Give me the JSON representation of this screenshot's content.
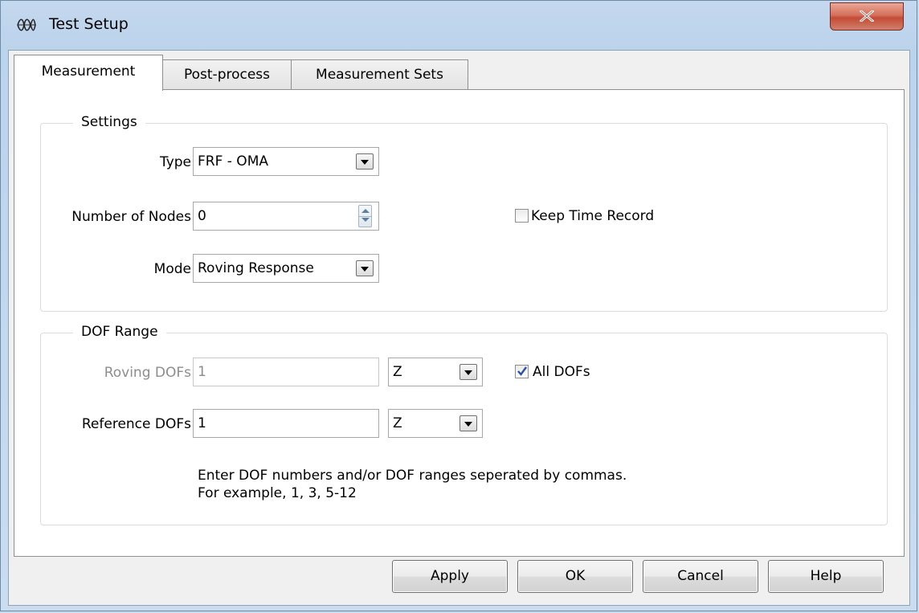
{
  "window": {
    "title": "Test Setup"
  },
  "tabs": [
    {
      "label": "Measurement",
      "active": true
    },
    {
      "label": "Post-process",
      "active": false
    },
    {
      "label": "Measurement Sets",
      "active": false
    }
  ],
  "settings": {
    "group_title": "Settings",
    "type_label": "Type",
    "type_value": "FRF - OMA",
    "nodes_label": "Number of Nodes",
    "nodes_value": "0",
    "keep_time_record_label": "Keep Time Record",
    "keep_time_record_checked": false,
    "mode_label": "Mode",
    "mode_value": "Roving Response"
  },
  "dof_range": {
    "group_title": "DOF Range",
    "roving_label": "Roving DOFs",
    "roving_value": "1",
    "roving_axis": "Z",
    "all_dofs_label": "All DOFs",
    "all_dofs_checked": true,
    "reference_label": "Reference DOFs",
    "reference_value": "1",
    "reference_axis": "Z",
    "hint_line1": "Enter DOF numbers and/or DOF ranges seperated by commas.",
    "hint_line2": "For example, 1, 3, 5-12"
  },
  "buttons": {
    "apply": "Apply",
    "ok": "OK",
    "cancel": "Cancel",
    "help": "Help"
  },
  "icons": {
    "app": "waveform-icon",
    "close": "close-icon",
    "combo": "chevron-down-icon",
    "spinner": "spinner-arrows-icon",
    "check": "checkmark-icon"
  },
  "colors": {
    "close_button": "#c44b36",
    "title_bar": "#c4d8ee",
    "checkmark": "#2b4fa8"
  }
}
